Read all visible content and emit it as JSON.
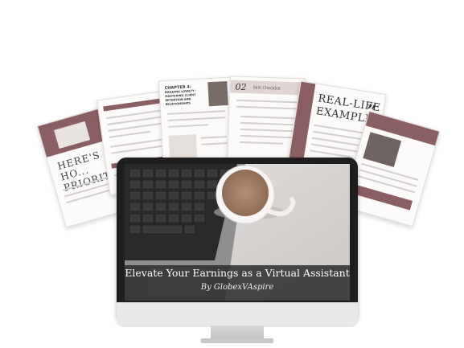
{
  "pages": {
    "left": {
      "title": "HERE'S HO... PRIORITI..."
    },
    "chapter4": {
      "heading": "CHAPTER 4:",
      "subheading": "BUILDING LOYALTY - MASTERING CLIENT RETENTION AND RELATIONSHIPS"
    },
    "checklist": {
      "number": "02",
      "title": "Skill Checklist"
    },
    "real_life": {
      "title_line1": "REAL-LIFE",
      "title_line2": "EXAMPLE",
      "quote_mark": "”"
    }
  },
  "screen": {
    "title": "Elevate Your Earnings as a Virtual Assistant",
    "byline": "By GlobexVAspire"
  },
  "colors": {
    "accent": "#8a5f64",
    "bezel": "#1e1e1e"
  }
}
